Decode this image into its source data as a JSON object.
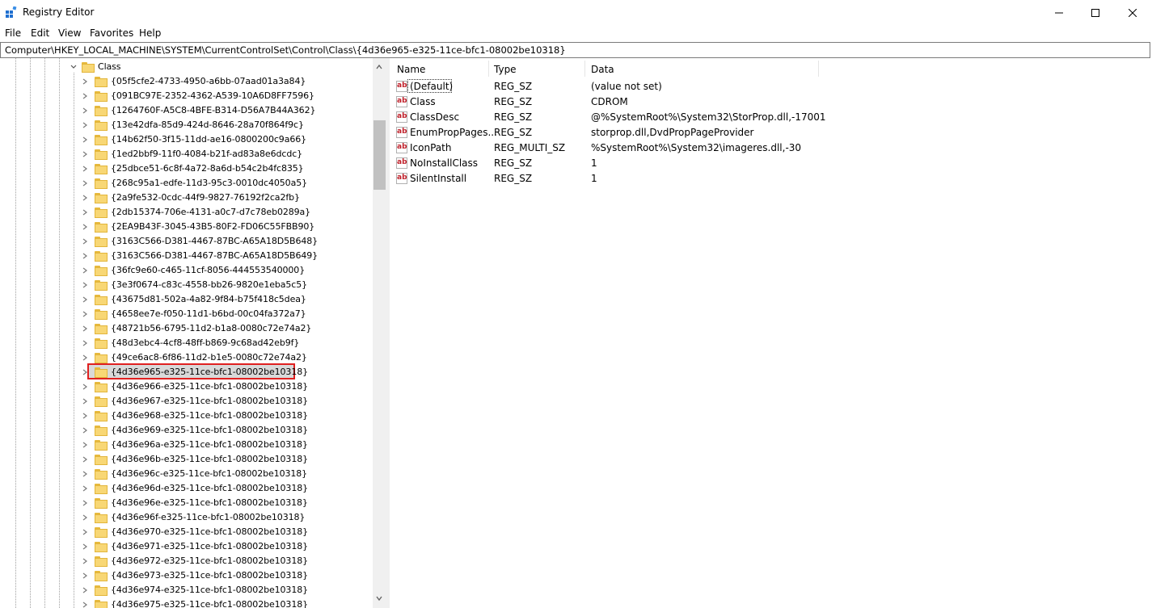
{
  "window": {
    "title": "Registry Editor"
  },
  "menu": [
    "File",
    "Edit",
    "View",
    "Favorites",
    "Help"
  ],
  "address": "Computer\\HKEY_LOCAL_MACHINE\\SYSTEM\\CurrentControlSet\\Control\\Class\\{4d36e965-e325-11ce-bfc1-08002be10318}",
  "tree": {
    "parent": "Class",
    "items": [
      "{05f5cfe2-4733-4950-a6bb-07aad01a3a84}",
      "{091BC97E-2352-4362-A539-10A6D8FF7596}",
      "{1264760F-A5C8-4BFE-B314-D56A7B44A362}",
      "{13e42dfa-85d9-424d-8646-28a70f864f9c}",
      "{14b62f50-3f15-11dd-ae16-0800200c9a66}",
      "{1ed2bbf9-11f0-4084-b21f-ad83a8e6dcdc}",
      "{25dbce51-6c8f-4a72-8a6d-b54c2b4fc835}",
      "{268c95a1-edfe-11d3-95c3-0010dc4050a5}",
      "{2a9fe532-0cdc-44f9-9827-76192f2ca2fb}",
      "{2db15374-706e-4131-a0c7-d7c78eb0289a}",
      "{2EA9B43F-3045-43B5-80F2-FD06C55FBB90}",
      "{3163C566-D381-4467-87BC-A65A18D5B648}",
      "{3163C566-D381-4467-87BC-A65A18D5B649}",
      "{36fc9e60-c465-11cf-8056-444553540000}",
      "{3e3f0674-c83c-4558-bb26-9820e1eba5c5}",
      "{43675d81-502a-4a82-9f84-b75f418c5dea}",
      "{4658ee7e-f050-11d1-b6bd-00c04fa372a7}",
      "{48721b56-6795-11d2-b1a8-0080c72e74a2}",
      "{48d3ebc4-4cf8-48ff-b869-9c68ad42eb9f}",
      "{49ce6ac8-6f86-11d2-b1e5-0080c72e74a2}",
      "{4d36e965-e325-11ce-bfc1-08002be10318}",
      "{4d36e966-e325-11ce-bfc1-08002be10318}",
      "{4d36e967-e325-11ce-bfc1-08002be10318}",
      "{4d36e968-e325-11ce-bfc1-08002be10318}",
      "{4d36e969-e325-11ce-bfc1-08002be10318}",
      "{4d36e96a-e325-11ce-bfc1-08002be10318}",
      "{4d36e96b-e325-11ce-bfc1-08002be10318}",
      "{4d36e96c-e325-11ce-bfc1-08002be10318}",
      "{4d36e96d-e325-11ce-bfc1-08002be10318}",
      "{4d36e96e-e325-11ce-bfc1-08002be10318}",
      "{4d36e96f-e325-11ce-bfc1-08002be10318}",
      "{4d36e970-e325-11ce-bfc1-08002be10318}",
      "{4d36e971-e325-11ce-bfc1-08002be10318}",
      "{4d36e972-e325-11ce-bfc1-08002be10318}",
      "{4d36e973-e325-11ce-bfc1-08002be10318}",
      "{4d36e974-e325-11ce-bfc1-08002be10318}",
      "{4d36e975-e325-11ce-bfc1-08002be10318}"
    ],
    "selected_index": 20
  },
  "list": {
    "columns": [
      "Name",
      "Type",
      "Data"
    ],
    "rows": [
      {
        "name": "(Default)",
        "type": "REG_SZ",
        "data": "(value not set)"
      },
      {
        "name": "Class",
        "type": "REG_SZ",
        "data": "CDROM"
      },
      {
        "name": "ClassDesc",
        "type": "REG_SZ",
        "data": "@%SystemRoot%\\System32\\StorProp.dll,-17001"
      },
      {
        "name": "EnumPropPages...",
        "type": "REG_SZ",
        "data": "storprop.dll,DvdPropPageProvider"
      },
      {
        "name": "IconPath",
        "type": "REG_MULTI_SZ",
        "data": "%SystemRoot%\\System32\\imageres.dll,-30"
      },
      {
        "name": "NoInstallClass",
        "type": "REG_SZ",
        "data": "1"
      },
      {
        "name": "SilentInstall",
        "type": "REG_SZ",
        "data": "1"
      }
    ]
  },
  "icons": {
    "value_icon": "ab",
    "value_icon_name": "string-value-icon",
    "folder_icon_name": "folder-icon"
  },
  "colors": {
    "highlight_border": "#e02020",
    "folder": "#f8d775",
    "icon_text": "#c0202a"
  }
}
